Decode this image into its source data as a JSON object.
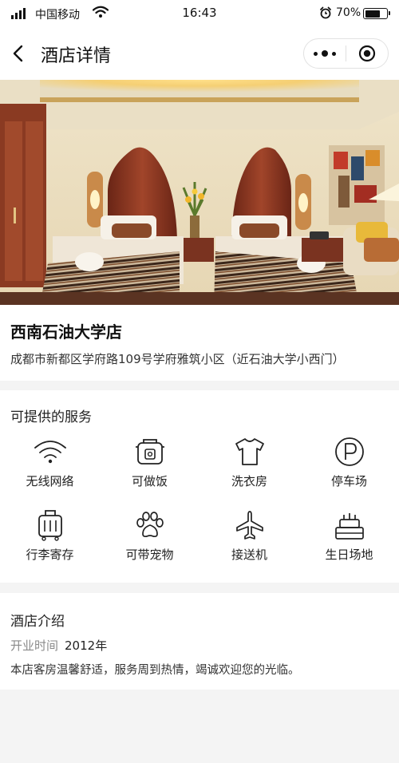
{
  "status_bar": {
    "carrier": "中国移动",
    "time": "16:43",
    "battery": "70%",
    "battery_level": 0.7
  },
  "nav": {
    "title": "酒店详情"
  },
  "hotel": {
    "name": "西南石油大学店",
    "address": "成都市新都区学府路109号学府雅筑小区（近石油大学小西门）"
  },
  "services": {
    "title": "可提供的服务",
    "items": [
      {
        "icon": "wifi-icon",
        "label": "无线网络"
      },
      {
        "icon": "rice-cooker-icon",
        "label": "可做饭"
      },
      {
        "icon": "shirt-icon",
        "label": "洗衣房"
      },
      {
        "icon": "parking-icon",
        "label": "停车场"
      },
      {
        "icon": "luggage-icon",
        "label": "行李寄存"
      },
      {
        "icon": "paw-icon",
        "label": "可带宠物"
      },
      {
        "icon": "airplane-icon",
        "label": "接送机"
      },
      {
        "icon": "birthday-cake-icon",
        "label": "生日场地"
      }
    ]
  },
  "intro": {
    "title": "酒店介绍",
    "open_label": "开业时间",
    "open_value": "2012年",
    "description": "本店客房温馨舒适，服务周到热情，竭诚欢迎您的光临。"
  }
}
